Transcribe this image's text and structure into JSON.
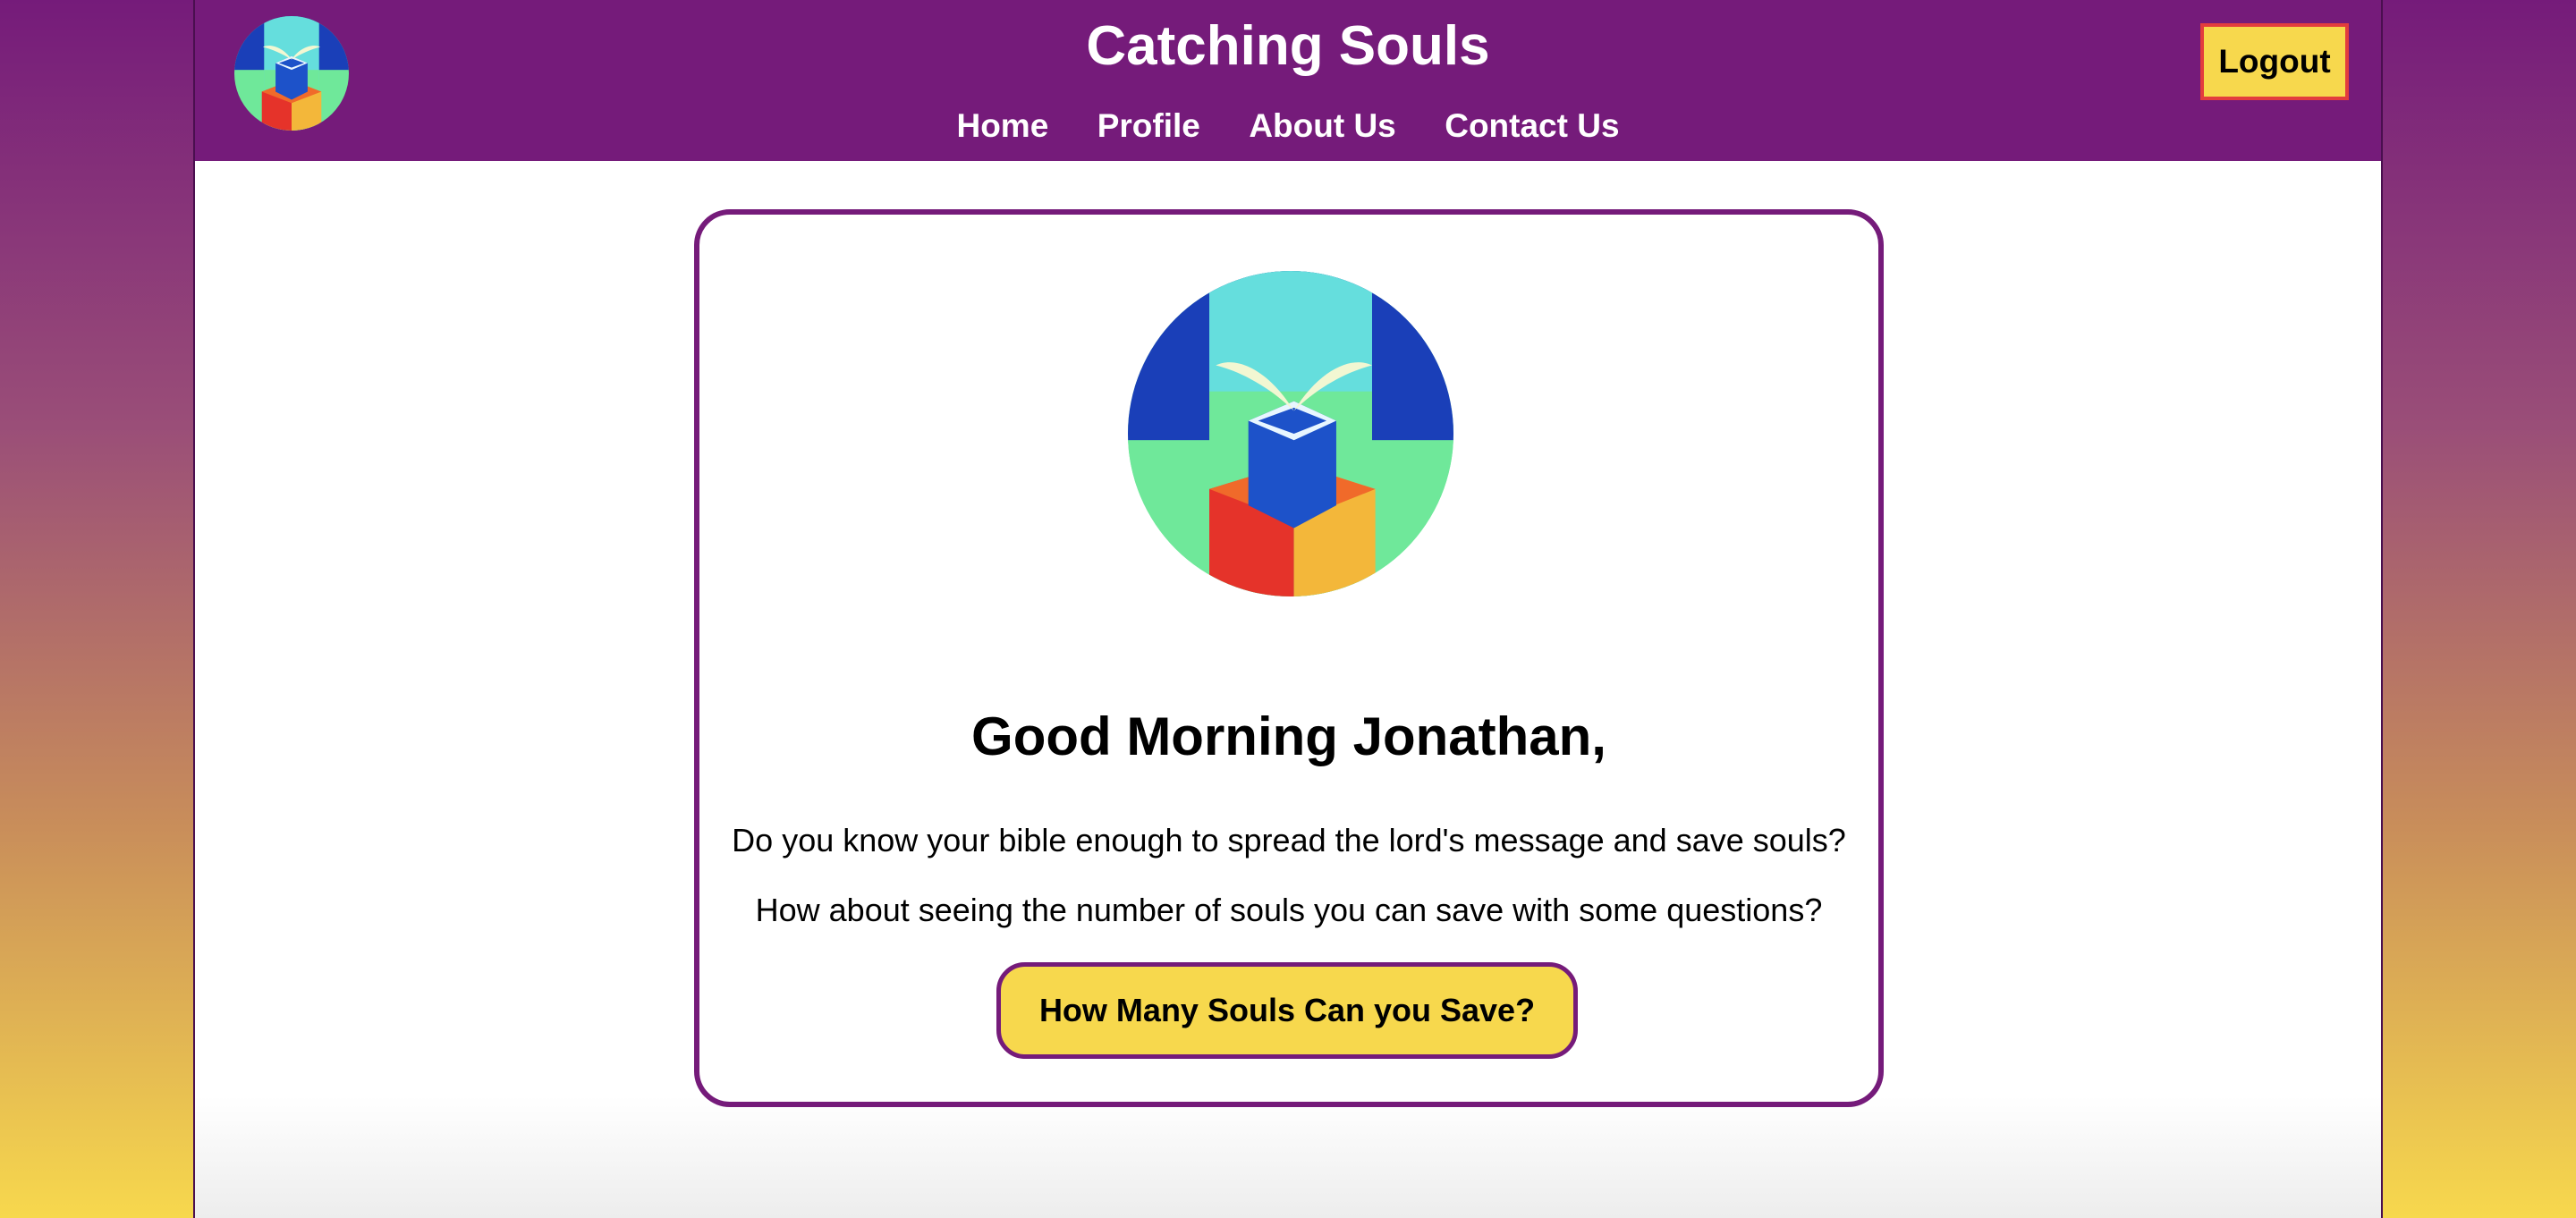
{
  "header": {
    "title": "Catching Souls",
    "logo_icon": "catching-souls-logo-icon",
    "nav": [
      {
        "label": "Home"
      },
      {
        "label": "Profile"
      },
      {
        "label": "About Us"
      },
      {
        "label": "Contact Us"
      }
    ],
    "logout_label": "Logout"
  },
  "main": {
    "logo_icon": "catching-souls-logo-icon",
    "greeting": "Good Morning Jonathan,",
    "line1": "Do you know your bible enough to spread the lord's message and save souls?",
    "line2": "How about seeing the number of souls you can save with some questions?",
    "cta_label": "How Many Souls Can you Save?"
  },
  "colors": {
    "brand_purple": "#751b7a",
    "accent_yellow": "#f7d84d",
    "logout_border": "#e33d3d"
  }
}
